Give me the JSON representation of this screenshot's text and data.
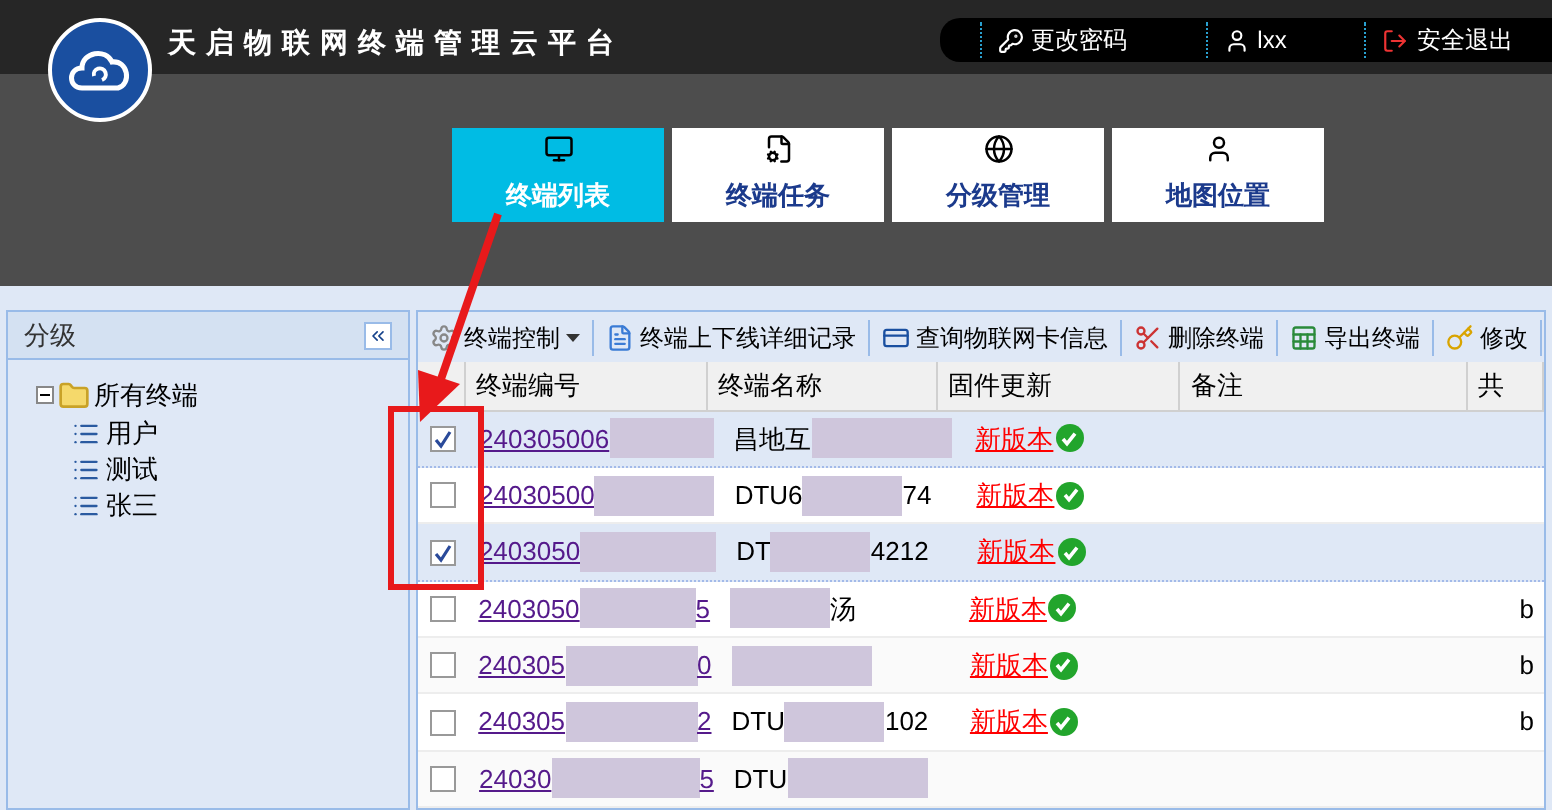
{
  "header": {
    "title": "天启物联网终端管理云平台",
    "links": [
      "更改密码",
      "lxx",
      "安全退出"
    ]
  },
  "nav": [
    {
      "label": "终端列表",
      "selected": true
    },
    {
      "label": "终端任务",
      "selected": false
    },
    {
      "label": "分级管理",
      "selected": false
    },
    {
      "label": "地图位置",
      "selected": false
    }
  ],
  "sidebar": {
    "title": "分级",
    "tree": [
      {
        "label": "所有终端",
        "expanded": true,
        "children": [
          {
            "label": "用户"
          },
          {
            "label": "测试"
          },
          {
            "label": "张三"
          }
        ]
      }
    ]
  },
  "toolbar": [
    "终端控制",
    "终端上下线详细记录",
    "查询物联网卡信息",
    "删除终端",
    "导出终端",
    "修改"
  ],
  "table": {
    "columns": [
      "终端编号",
      "终端名称",
      "固件更新",
      "备注",
      "共"
    ],
    "rows": [
      {
        "checked": true,
        "selected": true,
        "id": "240305006",
        "id_end": "",
        "name": "昌地互",
        "name_end": "",
        "firmware": "新版本",
        "col_5": ""
      },
      {
        "checked": false,
        "selected": false,
        "id": "24030500",
        "id_end": "",
        "name": "DTU6",
        "name_end": "74",
        "firmware": "新版本",
        "col_5": ""
      },
      {
        "checked": true,
        "selected": true,
        "id": "2403050",
        "id_end": "",
        "name": "DT",
        "name_end": "4212",
        "firmware": "新版本",
        "col_5": ""
      },
      {
        "checked": false,
        "selected": false,
        "id": "2403050",
        "id_end": "5",
        "name": "",
        "name_end": "汤",
        "firmware": "新版本",
        "col_5": "b"
      },
      {
        "checked": false,
        "selected": false,
        "id": "240305",
        "id_end": "0",
        "name": "",
        "name_end": "",
        "firmware": "新版本",
        "col_5": "b"
      },
      {
        "checked": false,
        "selected": false,
        "id": "240305",
        "id_end": "2",
        "name": "DTU",
        "name_end": "102",
        "firmware": "新版本",
        "col_5": "b"
      },
      {
        "checked": false,
        "selected": false,
        "id": "24030",
        "id_end": "5",
        "name": "DTU",
        "name_end": "",
        "firmware": "",
        "col_5": ""
      }
    ]
  }
}
